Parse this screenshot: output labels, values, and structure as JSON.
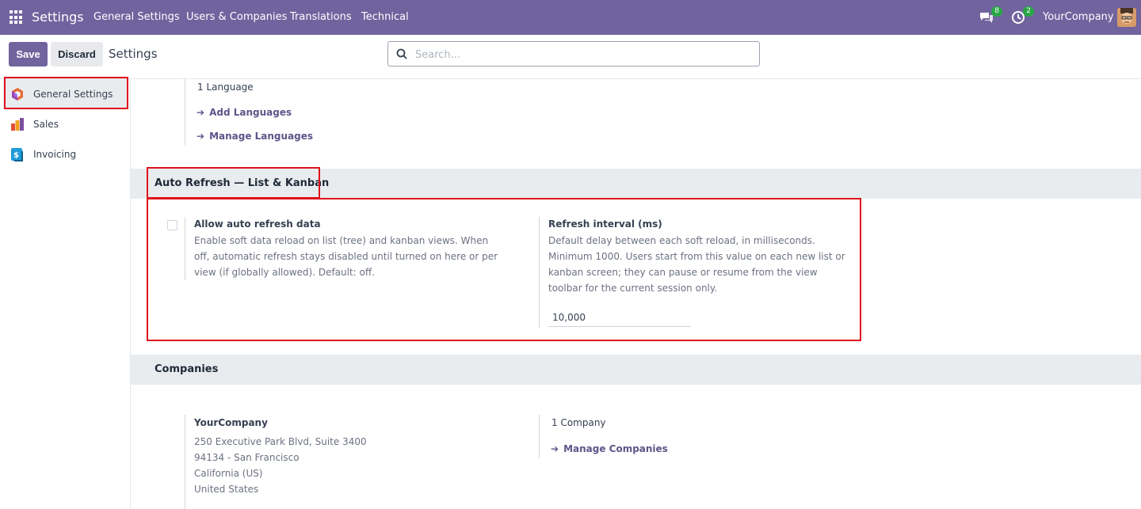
{
  "topbar": {
    "brand": "Settings",
    "nav": [
      "General Settings",
      "Users & Companies",
      "Translations",
      "Technical"
    ],
    "chat_count": "8",
    "activity_count": "2",
    "company": "YourCompany",
    "accent": "#71639e"
  },
  "control": {
    "save_label": "Save",
    "discard_label": "Discard",
    "title": "Settings",
    "search_placeholder": "Search..."
  },
  "sidebar": {
    "items": [
      {
        "label": "General Settings",
        "icon": "general-settings-icon"
      },
      {
        "label": "Sales",
        "icon": "sales-icon"
      },
      {
        "label": "Invoicing",
        "icon": "invoicing-icon"
      }
    ]
  },
  "languages": {
    "count": "1 Language",
    "add": "Add Languages",
    "manage": "Manage Languages"
  },
  "auto_refresh": {
    "title": "Auto Refresh — List & Kanban",
    "allow_title": "Allow auto refresh data",
    "allow_desc": "Enable soft data reload on list (tree) and kanban views. When off, automatic refresh stays disabled until turned on here or per view (if globally allowed). Default: off.",
    "interval_title": "Refresh interval (ms)",
    "interval_desc": "Default delay between each soft reload, in milliseconds. Minimum 1000. Users start from this value on each new list or kanban screen; they can pause or resume from the view toolbar for the current session only.",
    "interval_value": "10,000"
  },
  "companies": {
    "title": "Companies",
    "name": "YourCompany",
    "address": [
      "250 Executive Park Blvd, Suite 3400",
      "94134 - San Francisco",
      "California (US)",
      "United States"
    ],
    "count": "1 Company",
    "manage": "Manage Companies"
  }
}
